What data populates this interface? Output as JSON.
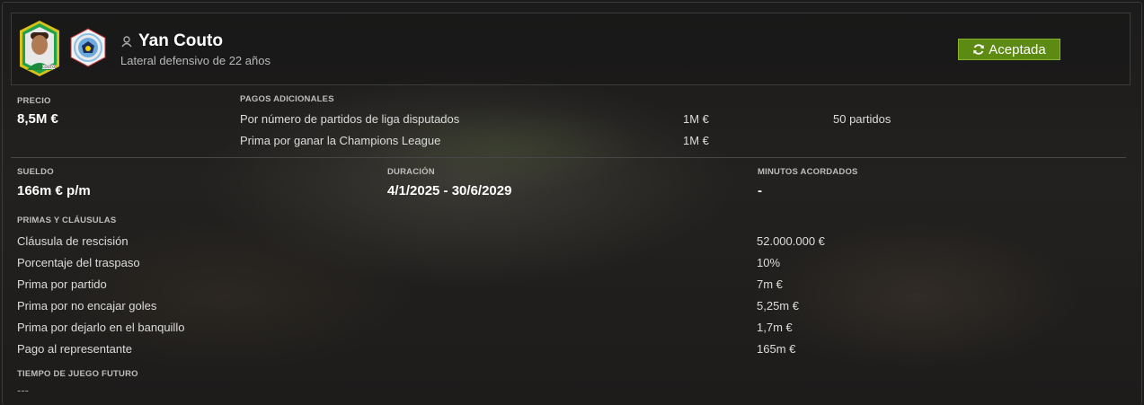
{
  "player": {
    "name": "Yan Couto",
    "subtitle": "Lateral defensivo de 22 años",
    "face_badge": "COUTO"
  },
  "status": {
    "label": "Aceptada",
    "color": "#5c8a13",
    "icon": "refresh-icon"
  },
  "price": {
    "label": "PRECIO",
    "value": "8,5M €"
  },
  "additional_payments": {
    "label": "PAGOS ADICIONALES",
    "rows": [
      {
        "name": "Por número de partidos de liga disputados",
        "amount": "1M €",
        "condition": "50 partidos"
      },
      {
        "name": "Prima por ganar la Champions League",
        "amount": "1M €",
        "condition": ""
      }
    ]
  },
  "salary": {
    "label": "SUELDO",
    "value": "166m € p/m"
  },
  "duration": {
    "label": "DURACIÓN",
    "value": "4/1/2025 - 30/6/2029"
  },
  "agreed_minutes": {
    "label": "MINUTOS ACORDADOS",
    "value": "-"
  },
  "bonuses": {
    "label": "PRIMAS Y CLÁUSULAS",
    "rows": [
      {
        "name": "Cláusula de rescisión",
        "value": "52.000.000 €"
      },
      {
        "name": "Porcentaje del traspaso",
        "value": "10%"
      },
      {
        "name": "Prima por partido",
        "value": "7m €"
      },
      {
        "name": "Prima por no encajar goles",
        "value": "5,25m €"
      },
      {
        "name": "Prima por dejarlo en el banquillo",
        "value": "1,7m €"
      },
      {
        "name": "Pago al representante",
        "value": "165m €"
      }
    ]
  },
  "future_playtime": {
    "label": "TIEMPO DE JUEGO FUTURO",
    "value": "---"
  }
}
